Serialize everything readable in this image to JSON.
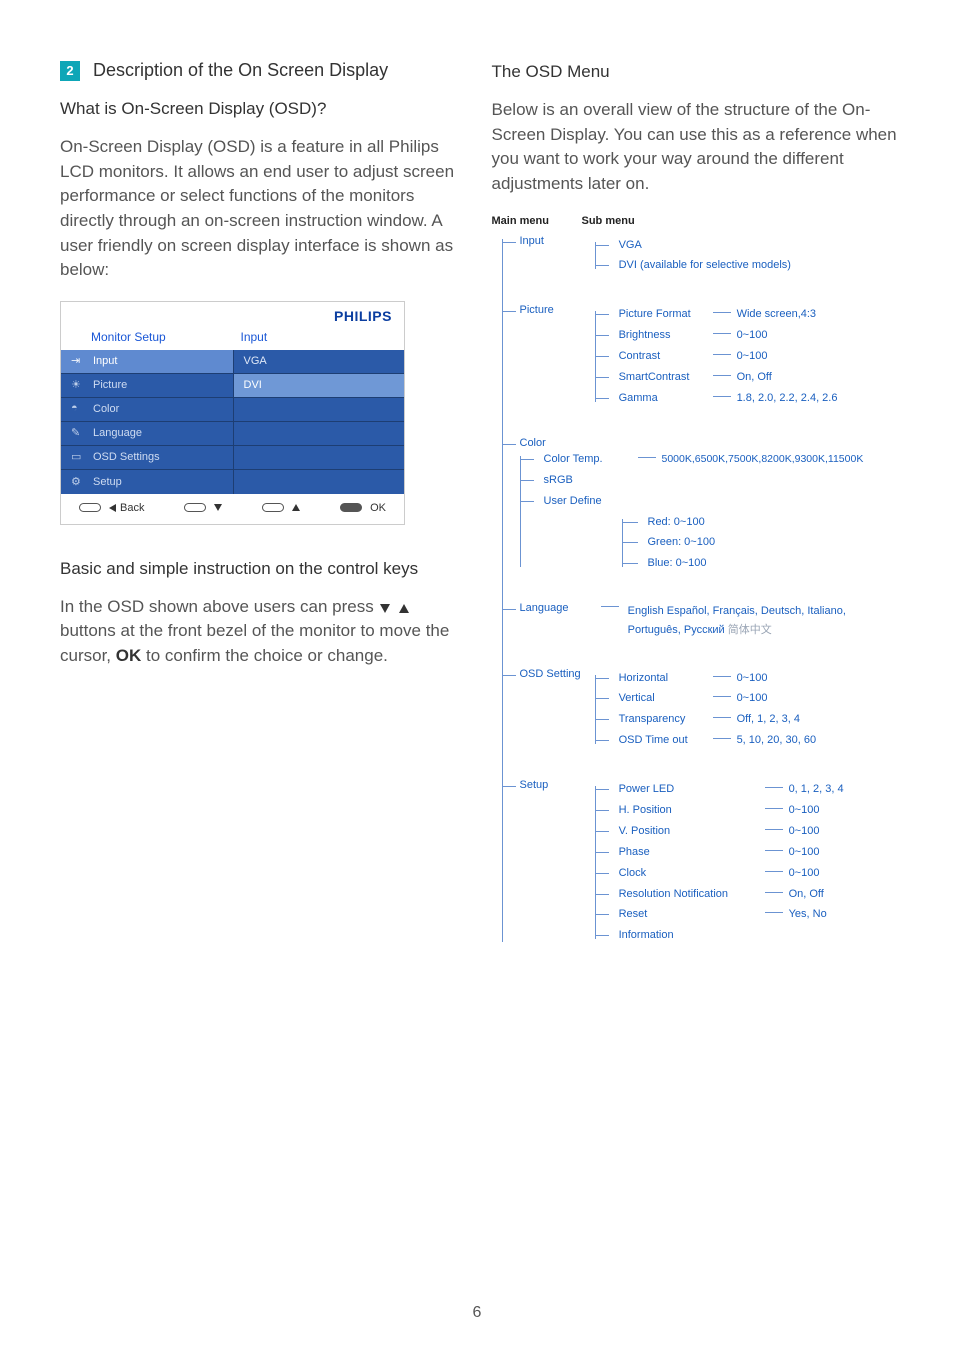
{
  "page_number": "6",
  "left": {
    "section_number": "2",
    "section_title": "Description of the On Screen Display",
    "q_heading": "What is On-Screen Display (OSD)?",
    "q_para": "On-Screen Display (OSD) is a feature in all Philips LCD monitors. It allows an end user to adjust screen performance or select functions of the monitors directly through an on-screen instruction window. A user friendly on screen display interface is shown as below:",
    "keys_heading": "Basic and simple instruction on the control keys",
    "keys_para_a": "In the OSD shown above users can press ",
    "keys_para_b": " buttons at the front bezel of the monitor to move the cursor, ",
    "keys_ok": "OK",
    "keys_para_c": " to confirm the choice or change."
  },
  "osd_shot": {
    "logo": "PHILIPS",
    "header_left": "Monitor Setup",
    "header_right": "Input",
    "menu": [
      "Input",
      "Picture",
      "Color",
      "Language",
      "OSD Settings",
      "Setup"
    ],
    "sub": [
      "VGA",
      "DVI",
      "",
      "",
      "",
      ""
    ],
    "back": "Back",
    "ok": "OK"
  },
  "right": {
    "title": "The OSD Menu",
    "intro": "Below is an overall view of the structure of the On-Screen Display. You can use this as a reference when you want to work your way around the different adjustments later on.",
    "hdr_main": "Main menu",
    "hdr_sub": "Sub menu"
  },
  "tree": {
    "input": {
      "label": "Input",
      "vga": "VGA",
      "dvi": "DVI (available for selective models)"
    },
    "picture": {
      "label": "Picture",
      "format_l": "Picture Format",
      "format_v": "Wide screen,4:3",
      "bright_l": "Brightness",
      "bright_v": "0~100",
      "contrast_l": "Contrast",
      "contrast_v": "0~100",
      "smart_l": "SmartContrast",
      "smart_v": "On, Off",
      "gamma_l": "Gamma",
      "gamma_v": "1.8, 2.0, 2.2, 2.4, 2.6"
    },
    "color": {
      "label": "Color",
      "temp_l": "Color Temp.",
      "temp_v": "5000K,6500K,7500K,8200K,9300K,11500K",
      "srgb": "sRGB",
      "user_l": "User Define",
      "red": "Red: 0~100",
      "green": "Green: 0~100",
      "blue": "Blue: 0~100"
    },
    "language": {
      "label": "Language",
      "line1": "English  Español, Français, Deutsch, Italiano,",
      "line2a": "Português, Русский",
      "line2b": "简体中文"
    },
    "osd": {
      "label": "OSD Setting",
      "h_l": "Horizontal",
      "h_v": "0~100",
      "v_l": "Vertical",
      "v_v": "0~100",
      "tr_l": "Transparency",
      "tr_v": "Off, 1, 2, 3, 4",
      "to_l": "OSD Time out",
      "to_v": "5, 10, 20, 30, 60"
    },
    "setup": {
      "label": "Setup",
      "led_l": "Power LED",
      "led_v": "0, 1, 2, 3, 4",
      "hp_l": "H. Position",
      "hp_v": "0~100",
      "vp_l": "V. Position",
      "vp_v": "0~100",
      "ph_l": "Phase",
      "ph_v": "0~100",
      "ck_l": "Clock",
      "ck_v": "0~100",
      "rn_l": "Resolution Notification",
      "rn_v": "On, Off",
      "rs_l": "Reset",
      "rs_v": "Yes, No",
      "info_l": "Information"
    }
  }
}
